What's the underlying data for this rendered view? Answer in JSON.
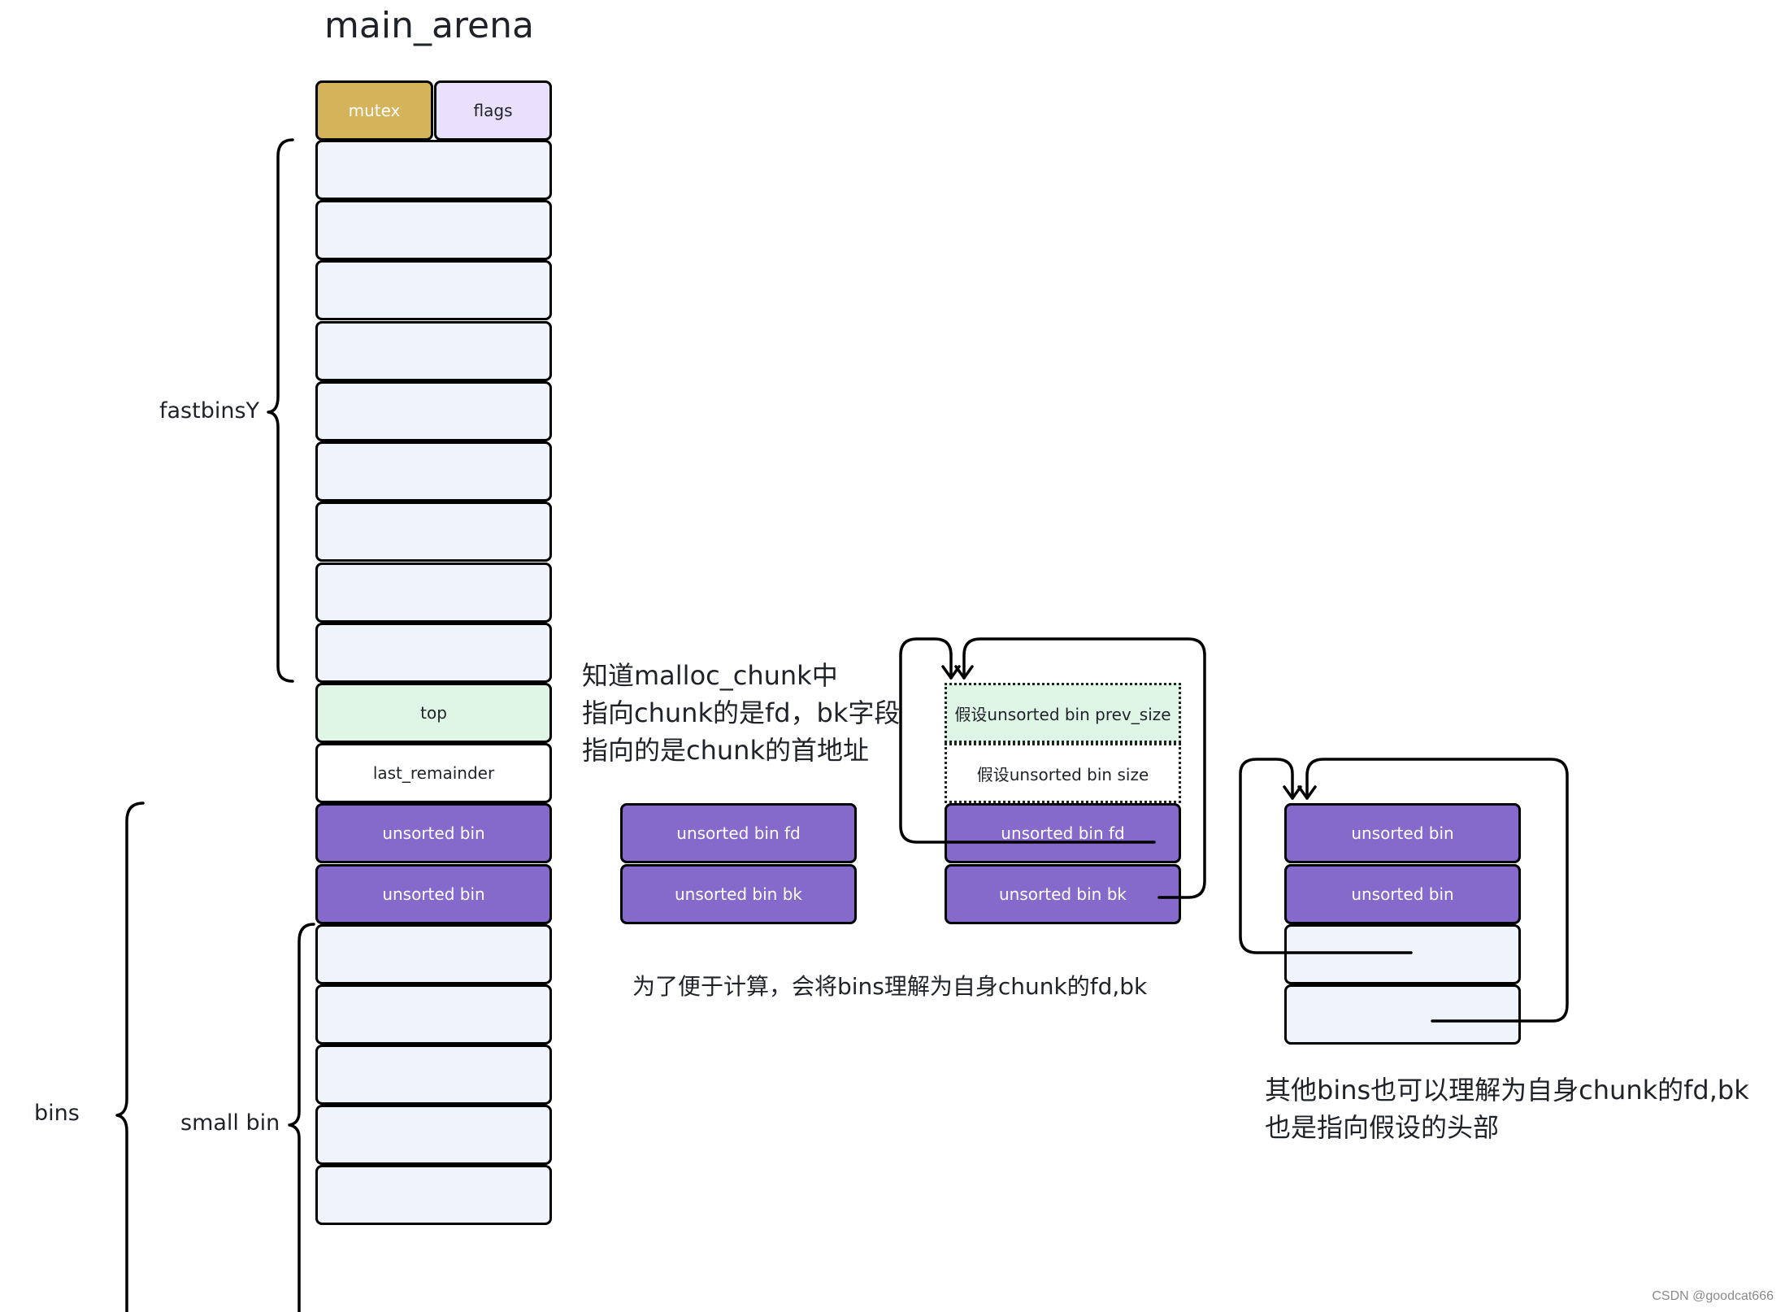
{
  "title": "main_arena",
  "arena": {
    "mutex_label": "mutex",
    "flags_label": "flags",
    "fastbins": [
      "",
      "",
      "",
      "",
      "",
      "",
      "",
      "",
      ""
    ],
    "top_label": "top",
    "last_remainder_label": "last_remainder",
    "unsorted": [
      "unsorted bin",
      "unsorted bin"
    ],
    "small_bins": [
      "",
      "",
      "",
      "",
      ""
    ]
  },
  "braces": {
    "fastbins_label": "fastbinsY",
    "bins_label": "bins",
    "small_bin_label": "small bin"
  },
  "middle_group": {
    "fd_label": "unsorted bin  fd",
    "bk_label": "unsorted bin bk",
    "caption": "为了便于计算，会将bins理解为自身chunk的fd,bk"
  },
  "right_group": {
    "prev_size_label": "假设unsorted bin prev_size",
    "size_label": "假设unsorted bin size",
    "fd_label": "unsorted bin fd",
    "bk_label": "unsorted bin bk"
  },
  "note_top": "知道malloc_chunk中\n指向chunk的是fd，bk字段\n指向的是chunk的首地址",
  "far_right_group": {
    "rows": [
      "unsorted bin",
      "unsorted bin",
      "",
      ""
    ],
    "caption": "其他bins也可以理解为自身chunk的fd,bk\n也是指向假设的头部"
  },
  "watermark": "CSDN @goodcat666"
}
